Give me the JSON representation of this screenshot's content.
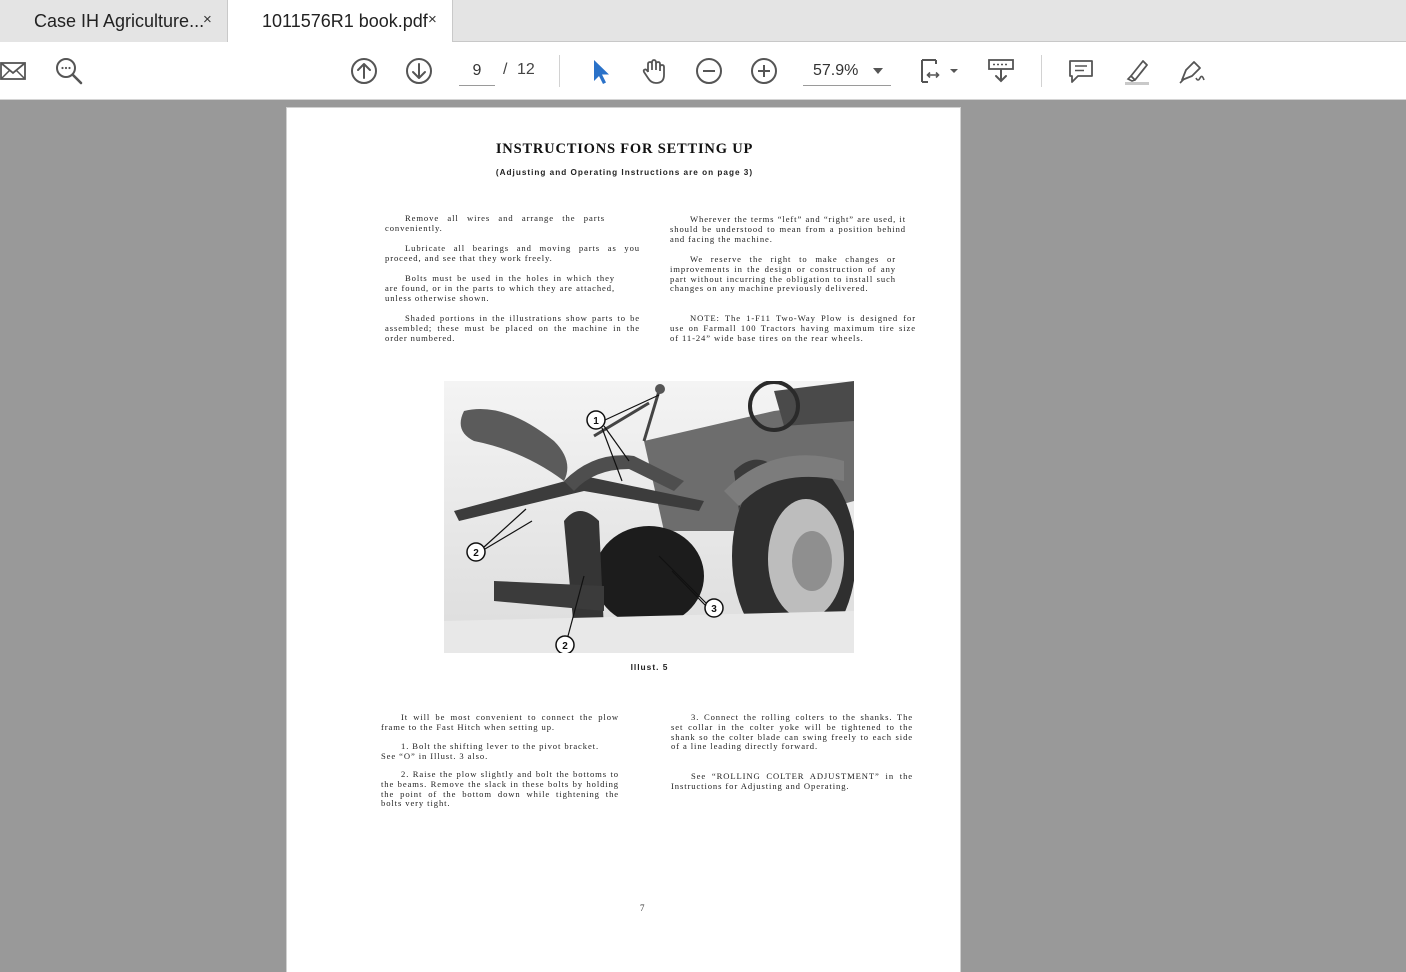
{
  "tabs": [
    {
      "label": "Case IH Agriculture...",
      "close": "×"
    },
    {
      "label": "1011576R1 book.pdf",
      "close": "×"
    }
  ],
  "toolbar": {
    "page_current": "9",
    "page_sep": "/",
    "page_total": "12",
    "zoom": "57.9%",
    "icons": [
      "mail-icon",
      "search-icon",
      "prev-page-icon",
      "next-page-icon",
      "select-cursor-icon",
      "hand-tool-icon",
      "zoom-out-icon",
      "zoom-in-icon",
      "fit-page-icon",
      "scroll-mode-icon",
      "comment-icon",
      "highlight-icon",
      "sign-icon"
    ],
    "accent_color": "#2a72c9"
  },
  "document": {
    "title": "INSTRUCTIONS FOR SETTING UP",
    "subtitle": "(Adjusting and Operating Instructions are on page 3)",
    "left_top": [
      "Remove all wires and arrange the parts conveniently.",
      "Lubricate all bearings and moving parts as you proceed, and see that they work freely.",
      "Bolts must be used in the holes in which they are found, or in the parts to which they are attached, unless otherwise shown.",
      "Shaded portions in the illustrations show parts to be assembled; these must be placed on the machine in the order numbered."
    ],
    "right_top": [
      "Wherever the terms “left” and “right” are used, it should be understood to mean from a position behind and facing the machine.",
      "We reserve the right to make changes or improvements in the design or construction of any part without incurring the obligation to install such changes on any machine previously delivered.",
      "NOTE: The 1-F11 Two-Way Plow is designed for use on Farmall 100 Tractors having maximum tire size of 11-24” wide base tires on the rear wheels."
    ],
    "callouts": [
      "1",
      "2",
      "3",
      "2"
    ],
    "caption": "Illust. 5",
    "left_bottom": [
      "It will be most convenient to connect the plow frame to the Fast Hitch when setting up.",
      "1. Bolt the shifting lever to the pivot bracket. See “O” in Illust. 3 also.",
      "2. Raise the plow slightly and bolt the bottoms to the beams. Remove the slack in these bolts by holding the point of the bottom down while tightening the bolts very tight."
    ],
    "right_bottom": [
      "3. Connect the rolling colters to the shanks. The set collar in the colter yoke will be tightened to the shank so the colter blade can swing freely to each side of a line leading directly forward.",
      "See “ROLLING COLTER ADJUSTMENT” in the Instructions for Adjusting and Operating."
    ],
    "page_number": "7"
  }
}
